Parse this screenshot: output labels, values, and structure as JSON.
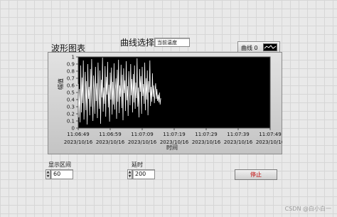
{
  "chart_title": "波形图表",
  "curve_select": {
    "label": "曲线选择",
    "value": "当前温度"
  },
  "legend": {
    "label": "曲线 0"
  },
  "chart_data": {
    "type": "line",
    "xlabel": "时间",
    "ylabel": "幅值",
    "ylim": [
      0,
      1
    ],
    "yticks": [
      "1",
      "0.9",
      "0.8",
      "0.7",
      "0.6",
      "0.5",
      "0.4",
      "0.3",
      "0.2",
      "0.1",
      "0"
    ],
    "xticks": [
      {
        "time": "11:06:49",
        "date": "2023/10/16"
      },
      {
        "time": "11:06:59",
        "date": "2023/10/16"
      },
      {
        "time": "11:07:09",
        "date": "2023/10/16"
      },
      {
        "time": "11:07:19",
        "date": "2023/10/16"
      },
      {
        "time": "11:07:29",
        "date": "2023/10/16"
      },
      {
        "time": "11:07:39",
        "date": "2023/10/16"
      },
      {
        "time": "11:07:49",
        "date": "2023/10/16"
      }
    ],
    "series": [
      {
        "color": "#ffffff",
        "x_seconds": [
          0,
          0.2,
          0.4,
          0.6,
          0.8,
          1.0,
          1.2,
          1.4,
          1.6,
          1.8,
          2.0,
          2.2,
          2.4,
          2.6,
          2.8,
          3.0,
          3.2,
          3.4,
          3.6,
          3.8,
          4.0,
          4.2,
          4.4,
          4.6,
          4.8,
          5.0,
          5.2,
          5.4,
          5.6,
          5.8,
          6.0,
          6.2,
          6.4,
          6.6,
          6.8,
          7.0,
          7.2,
          7.4,
          7.6,
          7.8,
          8.0,
          8.2,
          8.4,
          8.6,
          8.8,
          9.0,
          9.2,
          9.4,
          9.6,
          9.8,
          10.0,
          10.2,
          10.4,
          10.6,
          10.8,
          11.0,
          11.2,
          11.4,
          11.6,
          11.8,
          12.0,
          12.2,
          12.4,
          12.6,
          12.8,
          13.0,
          13.2,
          13.4,
          13.6,
          13.8,
          14.0,
          14.2,
          14.4,
          14.6,
          14.8,
          15.0,
          15.2,
          15.4,
          15.6,
          15.8,
          16.0,
          16.2,
          16.4,
          16.6,
          16.8,
          17.0,
          17.2,
          17.4,
          17.6,
          17.8,
          18.0,
          18.2,
          18.4,
          18.6,
          18.8,
          19.0,
          19.2,
          19.4,
          19.6,
          19.8,
          20.0,
          20.2,
          20.4,
          20.6,
          20.8,
          21.0,
          21.2,
          21.4,
          21.6,
          21.8,
          22.0,
          22.2,
          22.4,
          22.6,
          22.8,
          23.0,
          23.2,
          23.4,
          23.6,
          23.8,
          24.0,
          24.2,
          24.4,
          24.6,
          24.8,
          25.0,
          25.2,
          25.4,
          25.6,
          25.8
        ],
        "y": [
          0.62,
          0.15,
          0.55,
          0.08,
          0.88,
          0.22,
          0.71,
          0.35,
          0.95,
          0.12,
          0.48,
          0.79,
          0.25,
          0.66,
          0.05,
          0.9,
          0.41,
          0.58,
          0.18,
          0.83,
          0.3,
          0.97,
          0.45,
          0.1,
          0.74,
          0.52,
          0.2,
          0.86,
          0.38,
          0.63,
          0.14,
          0.92,
          0.5,
          0.27,
          0.81,
          0.06,
          0.68,
          0.43,
          0.99,
          0.23,
          0.57,
          0.34,
          0.87,
          0.16,
          0.72,
          0.47,
          0.93,
          0.29,
          0.61,
          0.09,
          0.78,
          0.4,
          0.85,
          0.19,
          0.65,
          0.33,
          0.91,
          0.26,
          0.54,
          0.7,
          0.13,
          0.82,
          0.37,
          0.96,
          0.21,
          0.6,
          0.44,
          0.89,
          0.28,
          0.75,
          0.11,
          0.84,
          0.49,
          0.67,
          0.24,
          0.94,
          0.39,
          0.59,
          0.17,
          0.8,
          0.53,
          0.32,
          0.9,
          0.46,
          0.69,
          0.22,
          0.76,
          0.36,
          0.88,
          0.27,
          0.64,
          0.42,
          0.98,
          0.3,
          0.57,
          0.15,
          0.83,
          0.51,
          0.73,
          0.2,
          0.86,
          0.45,
          0.62,
          0.34,
          0.92,
          0.25,
          0.7,
          0.4,
          0.81,
          0.18,
          0.66,
          0.5,
          0.95,
          0.31,
          0.58,
          0.37,
          0.77,
          0.44,
          0.6,
          0.35,
          0.52,
          0.63,
          0.41,
          0.55,
          0.38,
          0.47,
          0.36,
          0.5,
          0.33,
          0.42
        ]
      }
    ]
  },
  "display_range": {
    "label": "显示区间",
    "value": "60"
  },
  "delay": {
    "label": "延时",
    "value": "200"
  },
  "stop_button": {
    "label": "停止"
  },
  "watermark": "CSDN @白小白一"
}
